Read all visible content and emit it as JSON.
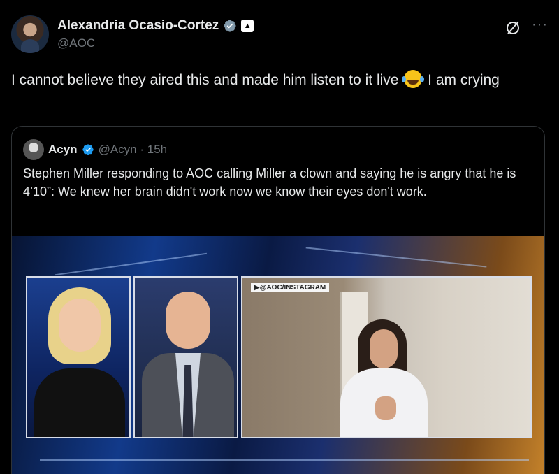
{
  "post": {
    "author_name": "Alexandria Ocasio-Cortez",
    "author_handle": "@AOC",
    "text_part1": "I cannot believe they aired this and made him listen to it live ",
    "text_part2": " I am crying",
    "emoji": "face-with-tears-of-joy",
    "more_label": "···",
    "badge_color": "#1d9bf0"
  },
  "quote": {
    "author_name": "Acyn",
    "author_handle": "@Acyn · 15h",
    "text": "Stephen Miller responding to AOC calling Miller a clown and saying he is angry that he is 4’10”: We knew her brain didn't work now we know their eyes don't work.",
    "media_label": "▶@AOC/INSTAGRAM"
  }
}
